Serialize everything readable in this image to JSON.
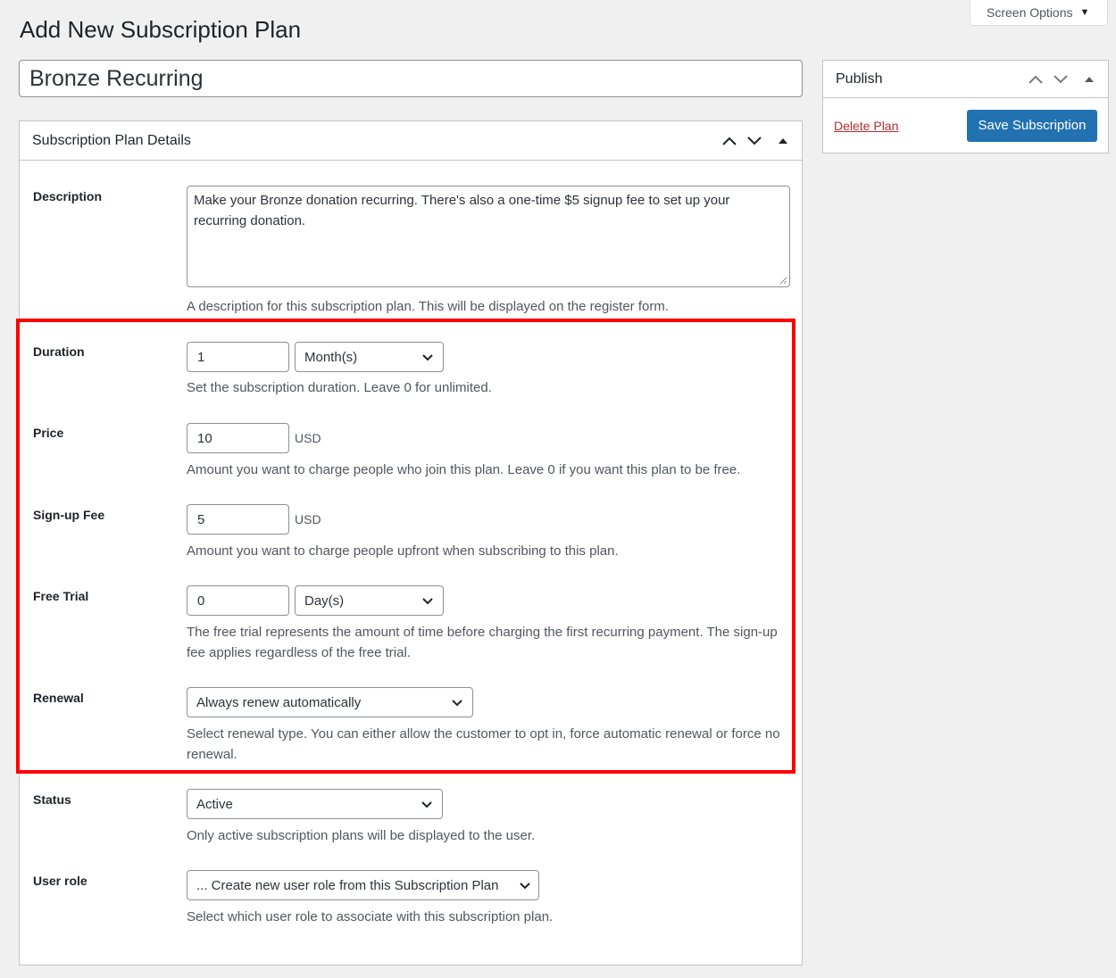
{
  "screen_options": {
    "label": "Screen Options"
  },
  "page": {
    "title": "Add New Subscription Plan"
  },
  "plan": {
    "name": "Bronze Recurring"
  },
  "publish": {
    "title": "Publish",
    "delete_label": "Delete Plan",
    "save_label": "Save Subscription"
  },
  "details": {
    "title": "Subscription Plan Details",
    "description": {
      "label": "Description",
      "value": "Make your Bronze donation recurring. There's also a one-time $5 signup fee to set up your recurring donation.",
      "help": "A description for this subscription plan. This will be displayed on the register form."
    },
    "duration": {
      "label": "Duration",
      "value": "1",
      "unit": "Month(s)",
      "help": "Set the subscription duration. Leave 0 for unlimited."
    },
    "price": {
      "label": "Price",
      "value": "10",
      "currency": "USD",
      "help": "Amount you want to charge people who join this plan. Leave 0 if you want this plan to be free."
    },
    "signup_fee": {
      "label": "Sign-up Fee",
      "value": "5",
      "currency": "USD",
      "help": "Amount you want to charge people upfront when subscribing to this plan."
    },
    "free_trial": {
      "label": "Free Trial",
      "value": "0",
      "unit": "Day(s)",
      "help": "The free trial represents the amount of time before charging the first recurring payment. The sign-up fee applies regardless of the free trial."
    },
    "renewal": {
      "label": "Renewal",
      "value": "Always renew automatically",
      "help": "Select renewal type. You can either allow the customer to opt in, force automatic renewal or force no renewal."
    },
    "status": {
      "label": "Status",
      "value": "Active",
      "help": "Only active subscription plans will be displayed to the user."
    },
    "user_role": {
      "label": "User role",
      "value": "... Create new user role from this Subscription Plan",
      "help": "Select which user role to associate with this subscription plan."
    }
  },
  "colors": {
    "accent": "#2271b1",
    "danger": "#b32d2e",
    "highlight": "#ff0000"
  }
}
